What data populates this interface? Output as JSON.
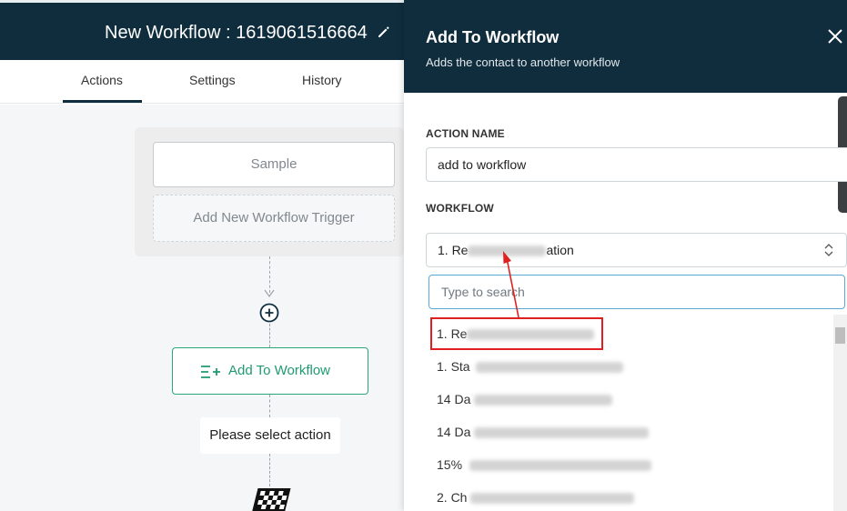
{
  "header": {
    "title": "New Workflow : 1619061516664",
    "edit_icon": "pencil-icon"
  },
  "tabs": [
    {
      "label": "Actions",
      "active": true
    },
    {
      "label": "Settings",
      "active": false
    },
    {
      "label": "History",
      "active": false
    }
  ],
  "builder": {
    "trigger_sample": "Sample",
    "add_trigger": "Add New Workflow Trigger",
    "node_label": "Add To Workflow",
    "node_icon": "list-add-icon",
    "select_action": "Please select action",
    "finish_icon": "finish-flag-icon"
  },
  "panel": {
    "title": "Add To Workflow",
    "subtitle": "Adds the contact to another workflow",
    "action_name_label": "ACTION NAME",
    "action_name_value": "add to workflow",
    "workflow_label": "WORKFLOW",
    "workflow_selected": "1. Re",
    "workflow_selected_tail": "ation",
    "search_placeholder": "Type to search",
    "options": [
      {
        "prefix": "1. Re"
      },
      {
        "prefix": "1. Sta"
      },
      {
        "prefix": "14 Da"
      },
      {
        "prefix": "14 Da"
      },
      {
        "prefix": "15%"
      },
      {
        "prefix": "2. Ch"
      }
    ]
  },
  "colors": {
    "header_bg": "#0f2d3d",
    "accent_green": "#1f9b6f",
    "highlight_red": "#e02020",
    "focus_blue": "#5aa9d6"
  }
}
